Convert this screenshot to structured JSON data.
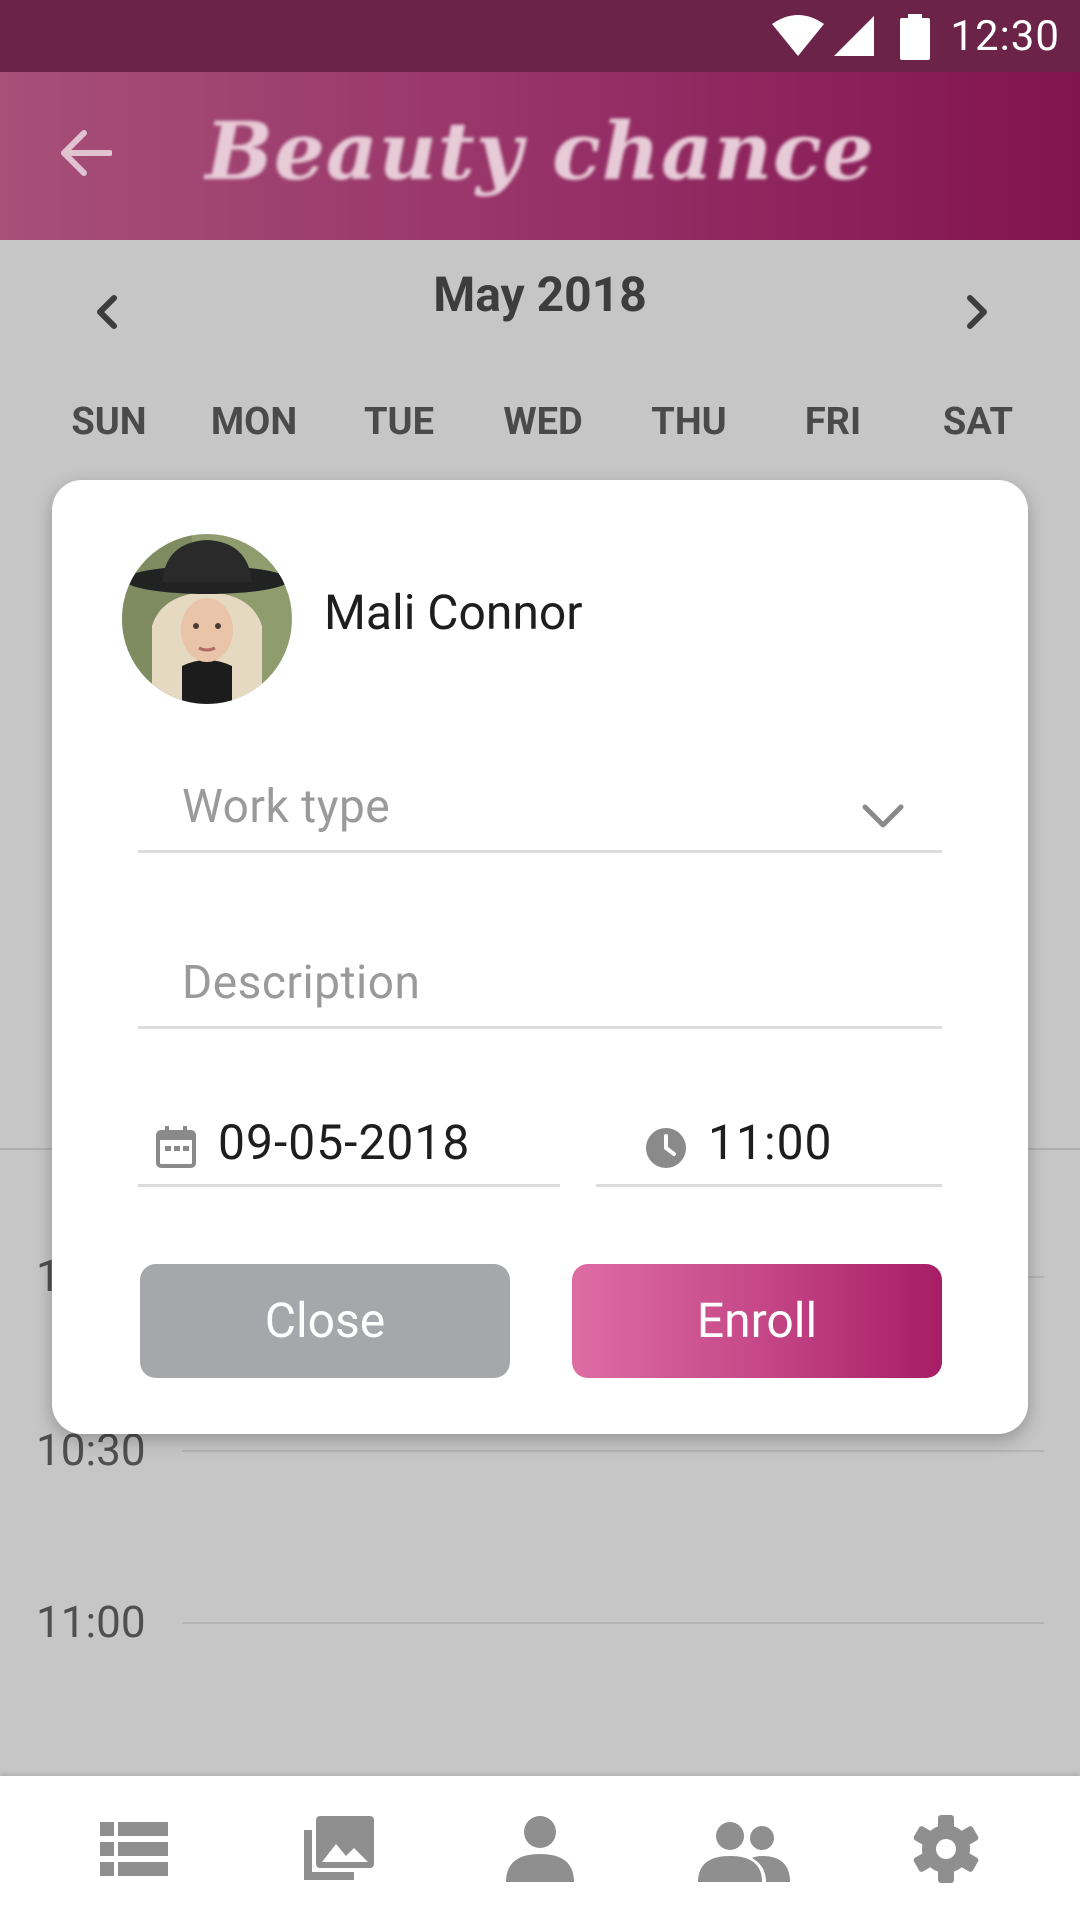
{
  "status_bar": {
    "time": "12:30"
  },
  "header": {
    "title": "Beauty chance"
  },
  "calendar": {
    "month_label": "May 2018",
    "weekdays": [
      "SUN",
      "MON",
      "TUE",
      "WED",
      "THU",
      "FRI",
      "SAT"
    ]
  },
  "schedule": {
    "slots": [
      "1",
      "10:30",
      "11:00"
    ]
  },
  "dialog": {
    "user_name": "Mali Connor",
    "work_type_placeholder": "Work type",
    "description_placeholder": "Description",
    "date_value": "09-05-2018",
    "time_value": "11:00",
    "close_label": "Close",
    "enroll_label": "Enroll"
  },
  "bottom_nav": {
    "items": [
      "list-icon",
      "gallery-icon",
      "person-icon",
      "people-icon",
      "settings-icon"
    ]
  },
  "colors": {
    "header_start": "#a75078",
    "header_end": "#82134f",
    "enroll_start": "#dd6da3",
    "enroll_end": "#a61d66",
    "close_button": "#a6a7ab",
    "icon_gray": "#8f8f8f"
  }
}
